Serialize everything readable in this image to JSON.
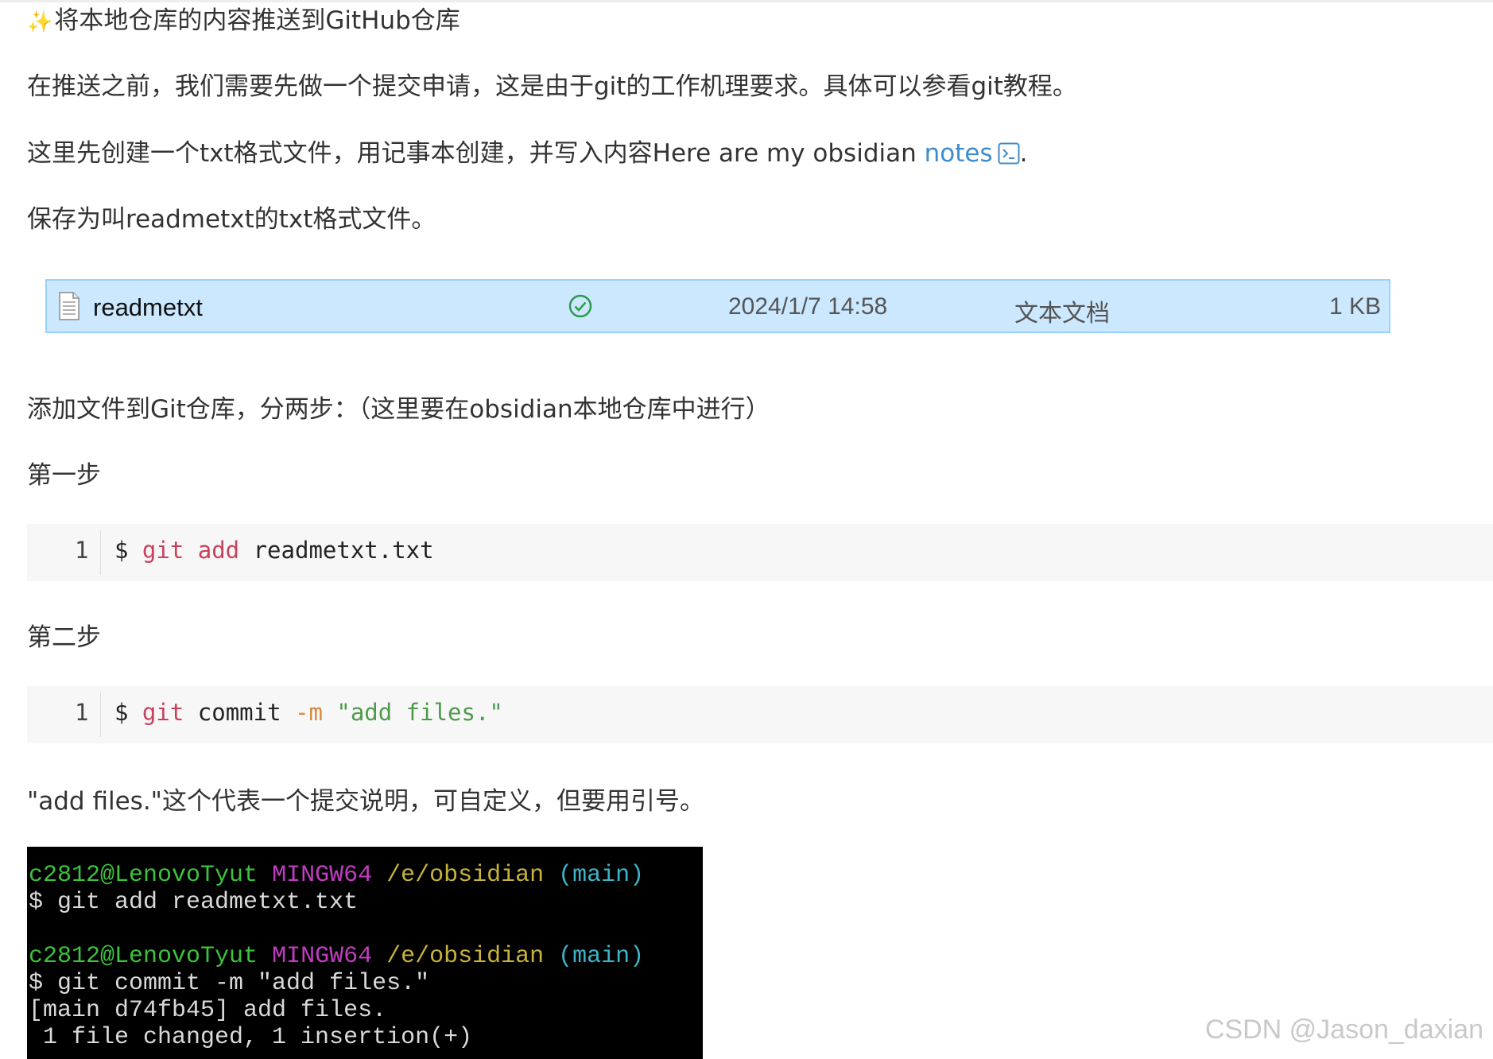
{
  "article": {
    "heading_emoji": "✨",
    "heading": "将本地仓库的内容推送到GitHub仓库",
    "p1": "在推送之前，我们需要先做一个提交申请，这是由于git的工作机理要求。具体可以参看git教程。",
    "p2_before": "这里先创建一个txt格式文件，用记事本创建，并写入内容Here are my obsidian ",
    "p2_link": "notes",
    "p2_after": ".",
    "p3": "保存为叫readmetxt的txt格式文件。",
    "p4": "添加文件到Git仓库，分两步：（这里要在obsidian本地仓库中进行）",
    "step1_label": "第一步",
    "step2_label": "第二步",
    "p5": "\"add files.\"这个代表一个提交说明，可自定义，但要用引号。"
  },
  "file_row": {
    "name": "readmetxt",
    "date": "2024/1/7 14:58",
    "type": "文本文档",
    "size": "1 KB"
  },
  "code1": {
    "line_number": "1",
    "prompt": "$ ",
    "cmd": "git add",
    "arg": " readmetxt.txt"
  },
  "code2": {
    "line_number": "1",
    "prompt": "$ ",
    "cmd": "git",
    "sub": " commit ",
    "opt": "-m",
    "str": " \"add files.\""
  },
  "terminal": {
    "user": "c2812@LenovoTyut",
    "host": "MINGW64",
    "path": "/e/obsidian",
    "branch": "(main)",
    "cmd1": "$ git add readmetxt.txt",
    "cmd2": "$ git commit -m \"add files.\"",
    "out1": "[main d74fb45] add files.",
    "out2": " 1 file changed, 1 insertion(+)"
  },
  "watermark": "CSDN @Jason_daxian",
  "colors": {
    "link": "#3d8ccc",
    "selection_bg": "#cce8ff",
    "selection_border": "#99d1ff",
    "code_keyword": "#c9405b",
    "code_option": "#d48a3a",
    "code_string": "#4f9a4a",
    "terminal_bg": "#000000"
  },
  "icons": [
    "sparkles-icon",
    "external-terminal-icon",
    "text-file-icon",
    "sync-ok-icon"
  ]
}
